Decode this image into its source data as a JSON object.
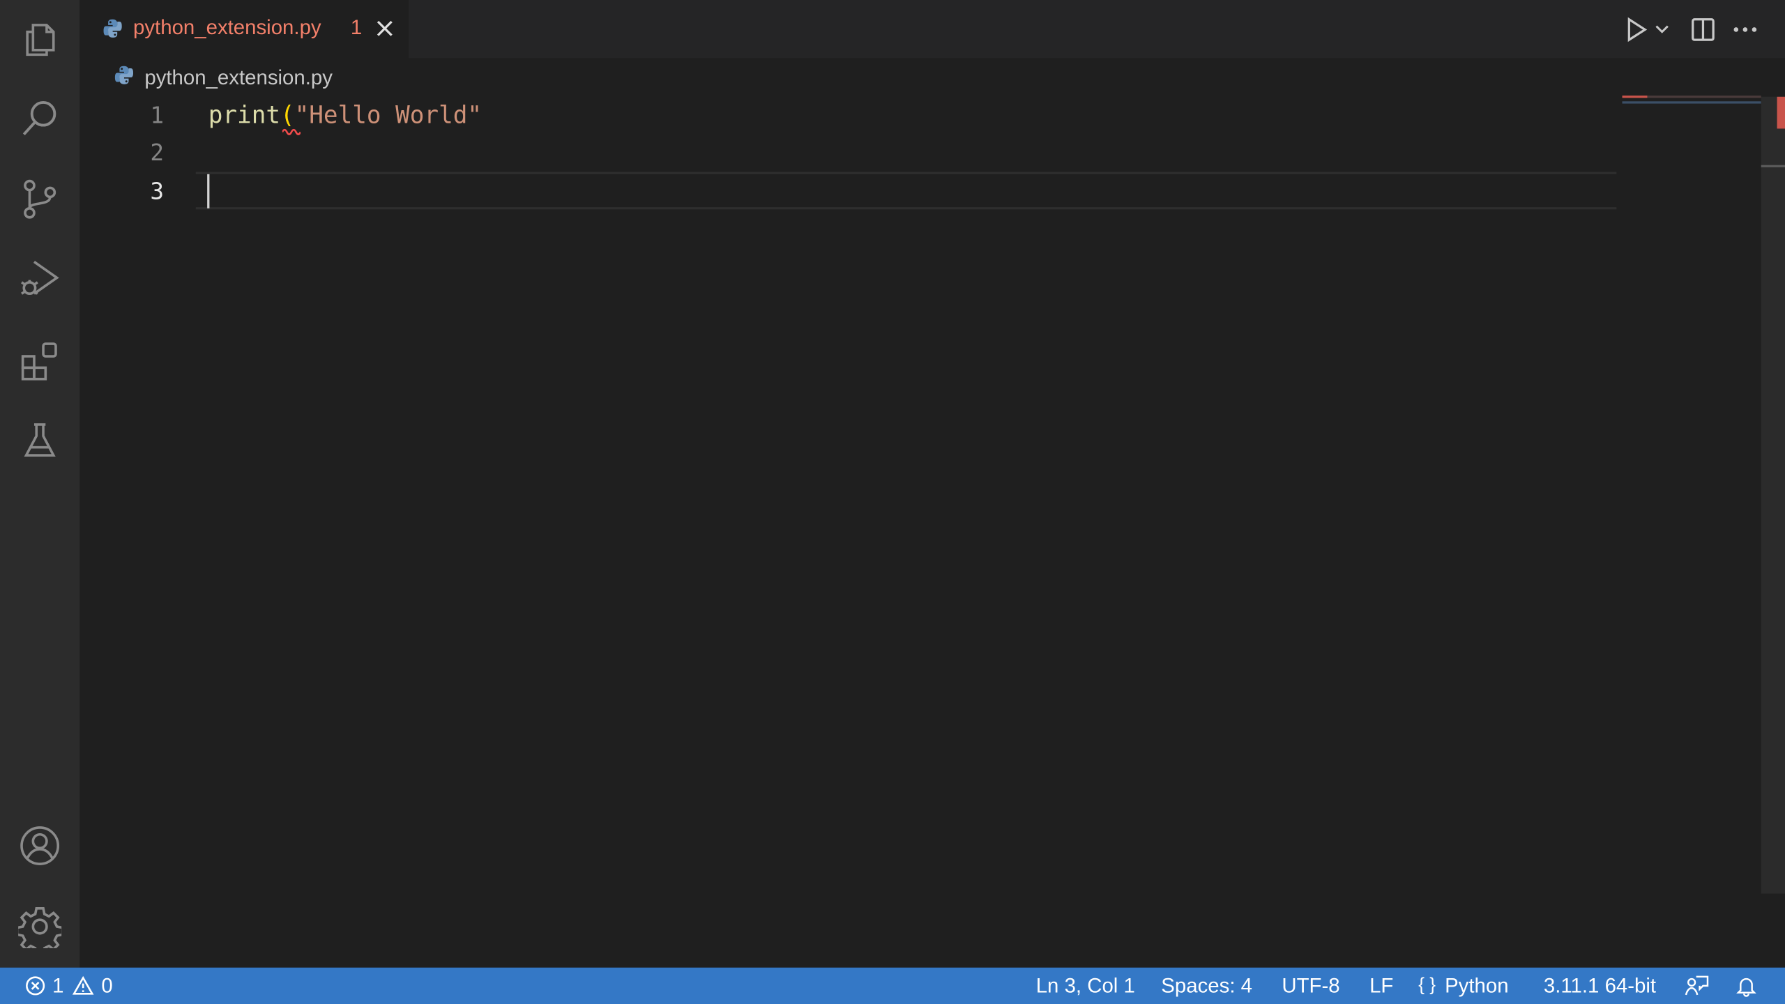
{
  "tab": {
    "filename": "python_extension.py",
    "problem_count": "1"
  },
  "breadcrumb": {
    "filename": "python_extension.py"
  },
  "editor": {
    "line_numbers": [
      "1",
      "2",
      "3"
    ],
    "code": {
      "line1_fn": "print",
      "line1_paren": "(",
      "line1_str": "\"Hello World\""
    }
  },
  "status": {
    "errors": "1",
    "warnings": "0",
    "cursor_position": "Ln 3, Col 1",
    "indentation": "Spaces: 4",
    "encoding": "UTF-8",
    "eol": "LF",
    "language_brace": "{ }",
    "language": "Python",
    "interpreter": "3.11.1 64-bit"
  },
  "colors": {
    "status_bar": "#3478c6",
    "activity_bar": "#2c2c2c",
    "editor_bg": "#1f1f1f",
    "error_tab_text": "#f3806a"
  },
  "icons": {
    "activity": [
      "explorer-icon",
      "search-icon",
      "source-control-icon",
      "run-debug-icon",
      "extensions-icon",
      "testing-icon",
      "accounts-icon",
      "manage-gear-icon"
    ],
    "editor_actions": [
      "run-icon",
      "chevron-down-icon",
      "split-editor-icon",
      "more-actions-icon"
    ],
    "status_right": [
      "feedback-icon",
      "bell-icon"
    ]
  }
}
